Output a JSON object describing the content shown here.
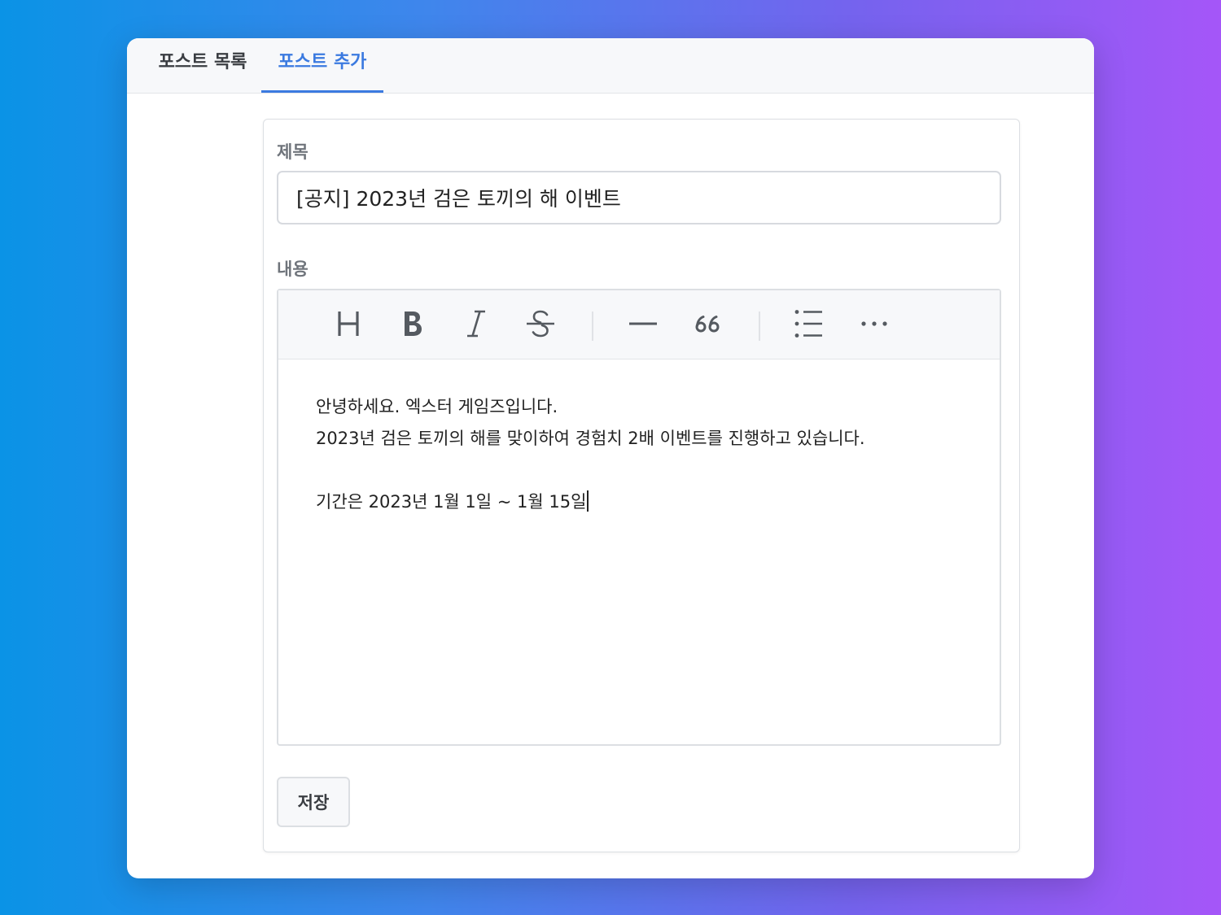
{
  "tabs": [
    {
      "label": "포스트 목록",
      "active": false
    },
    {
      "label": "포스트 추가",
      "active": true
    }
  ],
  "form": {
    "title_label": "제목",
    "title_value": "[공지] 2023년 검은 토끼의 해 이벤트",
    "content_label": "내용",
    "content_lines": [
      "안녕하세요. 엑스터 게임즈입니다.",
      "2023년 검은 토끼의 해를 맞이하여 경험치 2배 이벤트를 진행하고 있습니다.",
      "",
      "기간은 2023년 1월 1일 ~ 1월 15일"
    ],
    "save_label": "저장"
  },
  "toolbar": {
    "tools": [
      "heading-icon",
      "bold-icon",
      "italic-icon",
      "strikethrough-icon",
      "horizontal-rule-icon",
      "quote-icon",
      "bullet-list-icon",
      "more-icon"
    ]
  },
  "colors": {
    "accent": "#3b7ae0",
    "text": "#222222",
    "muted": "#6f747b",
    "border": "#dcdfe3",
    "toolbar_bg": "#f7f8fa"
  }
}
